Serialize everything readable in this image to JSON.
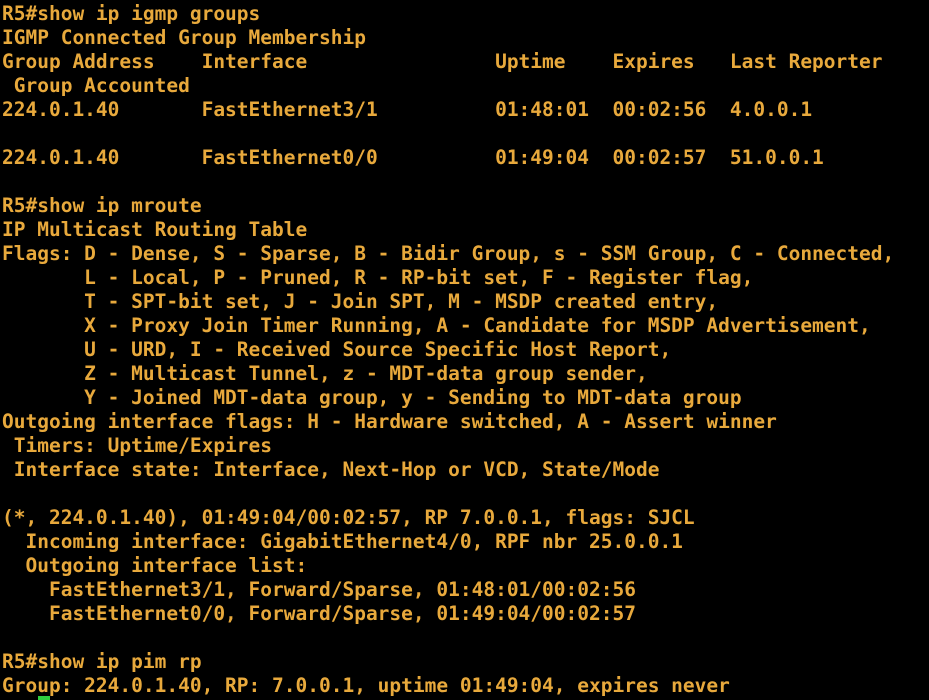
{
  "terminal": {
    "text_color": "#e8a93c",
    "background_color": "#000000",
    "cursor_color": "#2ecc40",
    "lines": [
      "R5#show ip igmp groups",
      "IGMP Connected Group Membership",
      "Group Address    Interface                Uptime    Expires   Last Reporter",
      " Group Accounted",
      "224.0.1.40       FastEthernet3/1          01:48:01  00:02:56  4.0.0.1",
      "",
      "224.0.1.40       FastEthernet0/0          01:49:04  00:02:57  51.0.0.1",
      "",
      "R5#show ip mroute",
      "IP Multicast Routing Table",
      "Flags: D - Dense, S - Sparse, B - Bidir Group, s - SSM Group, C - Connected,",
      "       L - Local, P - Pruned, R - RP-bit set, F - Register flag,",
      "       T - SPT-bit set, J - Join SPT, M - MSDP created entry,",
      "       X - Proxy Join Timer Running, A - Candidate for MSDP Advertisement,",
      "       U - URD, I - Received Source Specific Host Report,",
      "       Z - Multicast Tunnel, z - MDT-data group sender,",
      "       Y - Joined MDT-data group, y - Sending to MDT-data group",
      "Outgoing interface flags: H - Hardware switched, A - Assert winner",
      " Timers: Uptime/Expires",
      " Interface state: Interface, Next-Hop or VCD, State/Mode",
      "",
      "(*, 224.0.1.40), 01:49:04/00:02:57, RP 7.0.0.1, flags: SJCL",
      "  Incoming interface: GigabitEthernet4/0, RPF nbr 25.0.0.1",
      "  Outgoing interface list:",
      "    FastEthernet3/1, Forward/Sparse, 01:48:01/00:02:56",
      "    FastEthernet0/0, Forward/Sparse, 01:49:04/00:02:57",
      "",
      "R5#show ip pim rp",
      "Group: 224.0.1.40, RP: 7.0.0.1, uptime 01:49:04, expires never"
    ]
  }
}
